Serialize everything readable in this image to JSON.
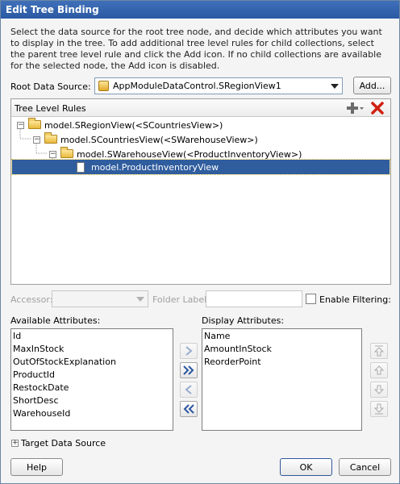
{
  "window": {
    "title": "Edit Tree Binding"
  },
  "description": "Select the data source for the root tree node, and decide which attributes you want to display in the tree. To add additional tree level rules for child collections, select the parent tree level rule and click the Add icon. If no child collections are available for the selected node, the Add icon is disabled.",
  "root_source": {
    "label": "Root Data Source:",
    "value": "AppModuleDataControl.SRegionView1",
    "add_label": "Add..."
  },
  "tree_rules": {
    "header": "Tree Level Rules",
    "nodes": [
      "model.SRegionView(<SCountriesView>)",
      "model.SCountriesView(<SWarehouseView>)",
      "model.SWarehouseView(<ProductInventoryView>)",
      "model.ProductInventoryView"
    ]
  },
  "filters": {
    "accessor_label": "Accessor:",
    "folder_label": "Folder Label:",
    "enable_filtering_label": "Enable Filtering:"
  },
  "available": {
    "label": "Available Attributes:",
    "items": [
      "Id",
      "MaxInStock",
      "OutOfStockExplanation",
      "ProductId",
      "RestockDate",
      "ShortDesc",
      "WarehouseId"
    ]
  },
  "display": {
    "label": "Display Attributes:",
    "items": [
      "Name",
      "AmountInStock",
      "ReorderPoint"
    ]
  },
  "target": {
    "label": "Target Data Source"
  },
  "footer": {
    "help_label": "Help",
    "ok_label": "OK",
    "cancel_label": "Cancel"
  },
  "colors": {
    "title_bar": "#2f62ad",
    "selection": "#2f5d9e",
    "delete_icon": "#d02010"
  }
}
